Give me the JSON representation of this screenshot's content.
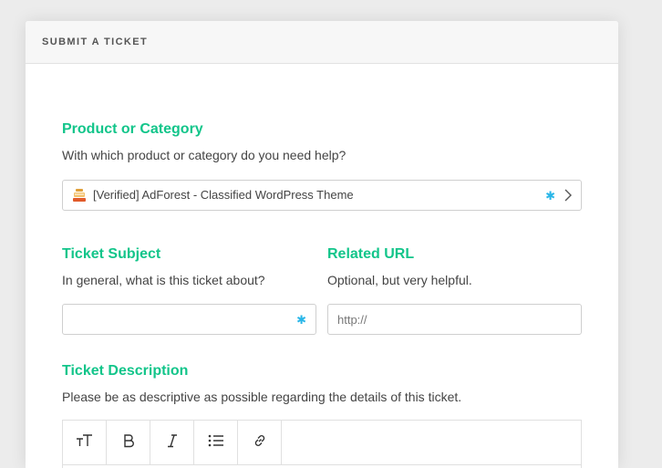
{
  "header": {
    "title": "SUBMIT A TICKET"
  },
  "product": {
    "label": "Product or Category",
    "help": "With which product or category do you need help?",
    "value": "[Verified] AdForest - Classified WordPress Theme",
    "required_mark": "✱",
    "icon": "product-thumbnail-icon"
  },
  "subject": {
    "label": "Ticket Subject",
    "help": "In general, what is this ticket about?",
    "value": "",
    "required_mark": "✱"
  },
  "related_url": {
    "label": "Related URL",
    "help": "Optional, but very helpful.",
    "placeholder": "http://"
  },
  "description": {
    "label": "Ticket Description",
    "help": "Please be as descriptive as possible regarding the details of this ticket.",
    "toolbar": [
      {
        "name": "text-size-icon",
        "label": "Text size"
      },
      {
        "name": "bold-icon",
        "label": "Bold"
      },
      {
        "name": "italic-icon",
        "label": "Italic"
      },
      {
        "name": "bullet-list-icon",
        "label": "Bulleted list"
      },
      {
        "name": "link-icon",
        "label": "Link"
      }
    ]
  },
  "colors": {
    "accent_green": "#12c58a",
    "required_blue": "#29b6e8"
  }
}
